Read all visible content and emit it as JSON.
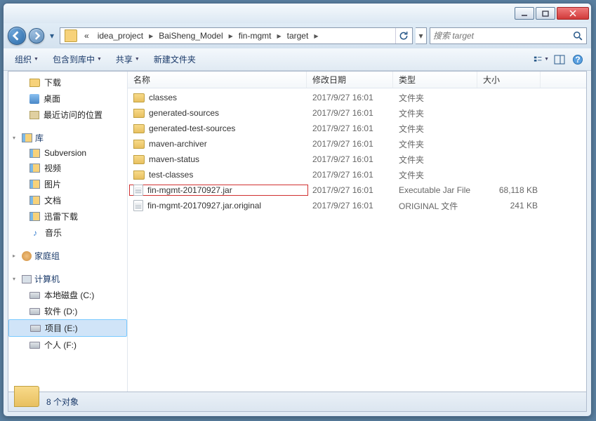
{
  "titlebar": {},
  "breadcrumbs": {
    "prefix": "«",
    "items": [
      "idea_project",
      "BaiSheng_Model",
      "fin-mgmt",
      "target"
    ]
  },
  "search": {
    "placeholder": "搜索 target"
  },
  "toolbar": {
    "organize": "组织",
    "include": "包含到库中",
    "share": "共享",
    "newfolder": "新建文件夹"
  },
  "sidebar": {
    "favorites": {
      "downloads": "下载",
      "desktop": "桌面",
      "recent": "最近访问的位置"
    },
    "libraries": {
      "header": "库",
      "subversion": "Subversion",
      "videos": "视频",
      "pictures": "图片",
      "documents": "文档",
      "xunlei": "迅雷下载",
      "music": "音乐"
    },
    "homegroup": "家庭组",
    "computer": {
      "header": "计算机",
      "drives": [
        {
          "label": "本地磁盘 (C:)"
        },
        {
          "label": "软件 (D:)"
        },
        {
          "label": "项目 (E:)"
        },
        {
          "label": "个人 (F:)"
        }
      ]
    }
  },
  "columns": {
    "name": "名称",
    "date": "修改日期",
    "type": "类型",
    "size": "大小"
  },
  "files": [
    {
      "name": "classes",
      "date": "2017/9/27 16:01",
      "type": "文件夹",
      "size": "",
      "icon": "folder"
    },
    {
      "name": "generated-sources",
      "date": "2017/9/27 16:01",
      "type": "文件夹",
      "size": "",
      "icon": "folder"
    },
    {
      "name": "generated-test-sources",
      "date": "2017/9/27 16:01",
      "type": "文件夹",
      "size": "",
      "icon": "folder"
    },
    {
      "name": "maven-archiver",
      "date": "2017/9/27 16:01",
      "type": "文件夹",
      "size": "",
      "icon": "folder"
    },
    {
      "name": "maven-status",
      "date": "2017/9/27 16:01",
      "type": "文件夹",
      "size": "",
      "icon": "folder"
    },
    {
      "name": "test-classes",
      "date": "2017/9/27 16:01",
      "type": "文件夹",
      "size": "",
      "icon": "folder"
    },
    {
      "name": "fin-mgmt-20170927.jar",
      "date": "2017/9/27 16:01",
      "type": "Executable Jar File",
      "size": "68,118 KB",
      "icon": "file",
      "highlight": true
    },
    {
      "name": "fin-mgmt-20170927.jar.original",
      "date": "2017/9/27 16:01",
      "type": "ORIGINAL 文件",
      "size": "241 KB",
      "icon": "file"
    }
  ],
  "details": {
    "count": "8 个对象"
  }
}
